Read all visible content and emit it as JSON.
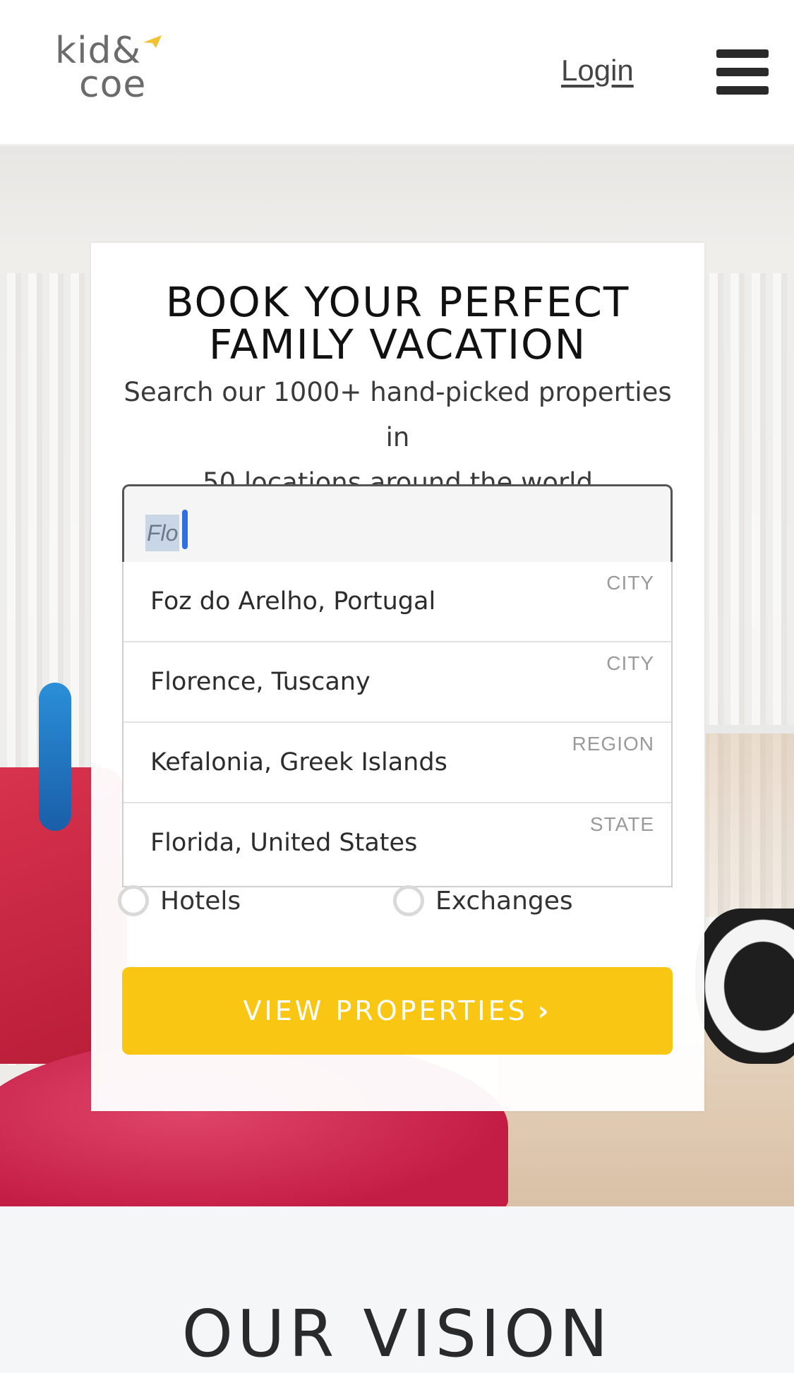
{
  "header": {
    "logo_line1": "kid&",
    "logo_line2": "coe",
    "login_label": "Login",
    "menu_icon": "hamburger-menu-icon"
  },
  "hero": {
    "headline_line1": "BOOK YOUR PERFECT",
    "headline_line2": "FAMILY VACATION",
    "subline_line1": "Search our 1000+ hand-picked properties in",
    "subline_line2": "50 locations around the world"
  },
  "search": {
    "value": "Flo"
  },
  "suggestions": [
    {
      "label": "Foz do Arelho, Portugal",
      "type": "CITY"
    },
    {
      "label": "Florence, Tuscany",
      "type": "CITY"
    },
    {
      "label": "Kefalonia, Greek Islands",
      "type": "REGION"
    },
    {
      "label": "Florida, United States",
      "type": "STATE"
    }
  ],
  "property_types": [
    {
      "label": "Hotels"
    },
    {
      "label": "Exchanges"
    }
  ],
  "cta": {
    "label": "VIEW PROPERTIES",
    "icon": "chevron-right-icon"
  },
  "sections": {
    "vision_title": "OUR VISION"
  },
  "colors": {
    "accent_yellow": "#f8c613",
    "logo_star": "#f2c230",
    "caret_blue": "#2f6de1"
  }
}
